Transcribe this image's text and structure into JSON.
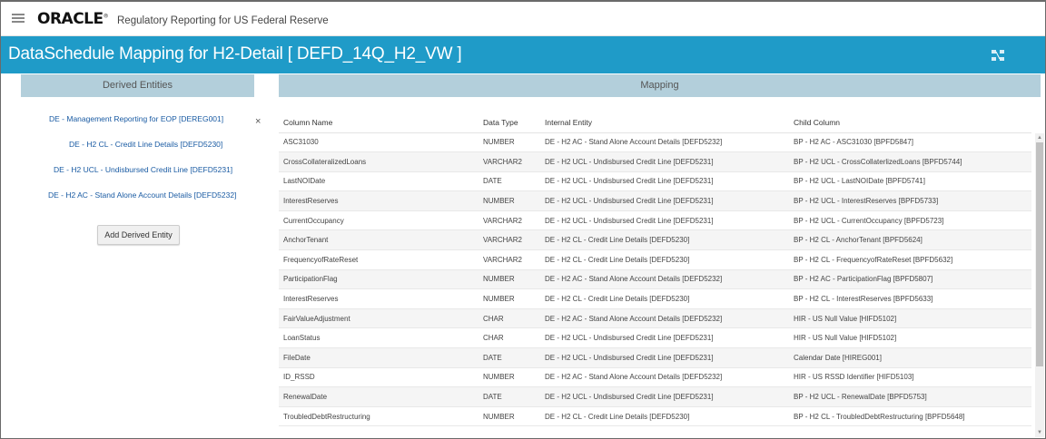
{
  "header": {
    "logo": "ORACLE",
    "app_name": "Regulatory Reporting for US Federal Reserve"
  },
  "title": "DataSchedule Mapping for H2-Detail [ DEFD_14Q_H2_VW ]",
  "left": {
    "header": "Derived Entities",
    "items": [
      {
        "label": "DE - Management Reporting for EOP [DEREG001]"
      },
      {
        "label": "DE - H2 CL - Credit Line Details [DEFD5230]"
      },
      {
        "label": "DE - H2 UCL - Undisbursed Credit Line [DEFD5231]"
      },
      {
        "label": "DE - H2 AC - Stand Alone Account Details [DEFD5232]"
      }
    ],
    "close_label": "×",
    "add_button": "Add Derived Entity"
  },
  "mapping": {
    "header": "Mapping",
    "columns": [
      "Column Name",
      "Data Type",
      "Internal Entity",
      "Child Column"
    ],
    "rows": [
      [
        "ASC31030",
        "NUMBER",
        "DE - H2 AC - Stand Alone Account Details [DEFD5232]",
        "BP - H2 AC - ASC31030 [BPFD5847]"
      ],
      [
        "CrossCollateralizedLoans",
        "VARCHAR2",
        "DE - H2 UCL - Undisbursed Credit Line [DEFD5231]",
        "BP - H2 UCL - CrossCollaterlizedLoans [BPFD5744]"
      ],
      [
        "LastNOIDate",
        "DATE",
        "DE - H2 UCL - Undisbursed Credit Line [DEFD5231]",
        "BP - H2 UCL - LastNOIDate [BPFD5741]"
      ],
      [
        "InterestReserves",
        "NUMBER",
        "DE - H2 UCL - Undisbursed Credit Line [DEFD5231]",
        "BP - H2 UCL - InterestReserves [BPFD5733]"
      ],
      [
        "CurrentOccupancy",
        "VARCHAR2",
        "DE - H2 UCL - Undisbursed Credit Line [DEFD5231]",
        "BP - H2 UCL - CurrentOccupancy [BPFD5723]"
      ],
      [
        "AnchorTenant",
        "VARCHAR2",
        "DE - H2 CL - Credit Line Details [DEFD5230]",
        "BP - H2 CL - AnchorTenant [BPFD5624]"
      ],
      [
        "FrequencyofRateReset",
        "VARCHAR2",
        "DE - H2 CL - Credit Line Details [DEFD5230]",
        "BP - H2 CL - FrequencyofRateReset [BPFD5632]"
      ],
      [
        "ParticipationFlag",
        "NUMBER",
        "DE - H2 AC - Stand Alone Account Details [DEFD5232]",
        "BP - H2 AC - ParticipationFlag [BPFD5807]"
      ],
      [
        "InterestReserves",
        "NUMBER",
        "DE - H2 CL - Credit Line Details [DEFD5230]",
        "BP - H2 CL - InterestReserves [BPFD5633]"
      ],
      [
        "FairValueAdjustment",
        "CHAR",
        "DE - H2 AC - Stand Alone Account Details [DEFD5232]",
        "HIR - US Null Value [HIFD5102]"
      ],
      [
        "LoanStatus",
        "CHAR",
        "DE - H2 UCL - Undisbursed Credit Line [DEFD5231]",
        "HIR - US Null Value [HIFD5102]"
      ],
      [
        "FileDate",
        "DATE",
        "DE - H2 UCL - Undisbursed Credit Line [DEFD5231]",
        "Calendar Date [HIREG001]"
      ],
      [
        "ID_RSSD",
        "NUMBER",
        "DE - H2 AC - Stand Alone Account Details [DEFD5232]",
        "HIR - US RSSD Identifier [HIFD5103]"
      ],
      [
        "RenewalDate",
        "DATE",
        "DE - H2 UCL - Undisbursed Credit Line [DEFD5231]",
        "BP - H2 UCL - RenewalDate [BPFD5753]"
      ],
      [
        "TroubledDebtRestructuring",
        "NUMBER",
        "DE - H2 CL - Credit Line Details [DEFD5230]",
        "BP - H2 CL - TroubledDebtRestructuring [BPFD5648]"
      ]
    ]
  },
  "colors": {
    "title_band": "#1f9bc8",
    "panel_header": "#b3cfdb",
    "link": "#1a5ba3"
  },
  "icons": {
    "menu": "hamburger-icon",
    "expand": "expand-icon",
    "remove": "close-icon"
  }
}
